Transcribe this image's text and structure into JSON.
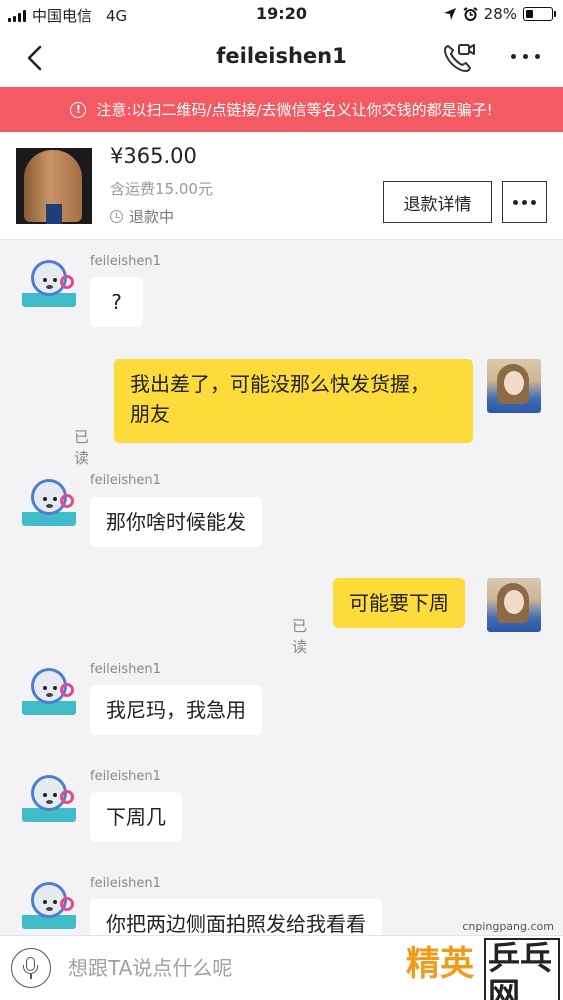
{
  "status_bar": {
    "carrier": "中国电信",
    "network": "4G",
    "time": "19:20",
    "battery": "28%",
    "battery_level": 0.28
  },
  "nav": {
    "title": "feileishen1",
    "back_icon": "chevron-left-icon",
    "call_icon": "video-call-icon",
    "more_icon": "more-dots-icon"
  },
  "warning": {
    "icon": "info-icon",
    "text": "注意:以扫二维码/点链接/去微信等名义让你交钱的都是骗子!"
  },
  "product": {
    "price": "¥365.00",
    "shipping": "含运费15.00元",
    "status": "退款中",
    "refund_button": "退款详情"
  },
  "messages": [
    {
      "side": "in",
      "sender": "feileishen1",
      "text": "?"
    },
    {
      "side": "out",
      "lines": [
        "我出差了，可能没那么快发货握，",
        "朋友"
      ],
      "read": "已读"
    },
    {
      "side": "in",
      "sender": "feileishen1",
      "text": "那你啥时候能发"
    },
    {
      "side": "out",
      "text": "可能要下周",
      "read": "已读"
    },
    {
      "side": "in",
      "sender": "feileishen1",
      "text": "我尼玛，我急用"
    },
    {
      "side": "in",
      "sender": "feileishen1",
      "text": "下周几"
    },
    {
      "side": "in",
      "sender": "feileishen1",
      "text": "你把两边侧面拍照发给我看看"
    }
  ],
  "input": {
    "placeholder": "想跟TA说点什么呢",
    "mic_icon": "microphone-icon"
  },
  "watermark": {
    "url": "cnpingpang.com",
    "logo_left": "精英",
    "logo_right": "乒乓网"
  },
  "colors": {
    "warning_bg": "#f35a63",
    "outgoing_bubble": "#fddb3a",
    "incoming_bubble": "#ffffff",
    "chat_bg": "#f3f3f5"
  }
}
